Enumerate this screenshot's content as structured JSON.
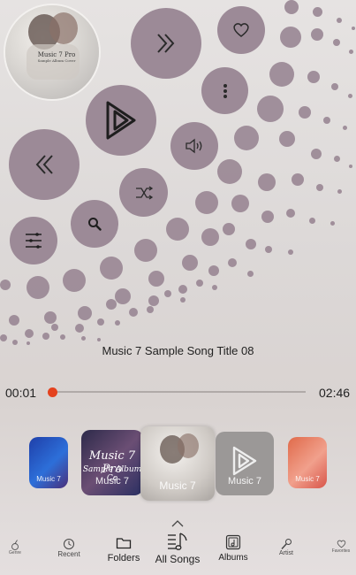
{
  "player": {
    "song_title": "Music 7 Sample Song Title 08",
    "elapsed": "00:01",
    "duration": "02:46",
    "progress": 0.006,
    "album_art_title": "Music 7 Pro",
    "album_art_subtitle": "Sample Album Cover"
  },
  "controls": {
    "icons": [
      "fast-forward-icon",
      "heart-icon",
      "more-vertical-icon",
      "play-icon",
      "volume-icon",
      "rewind-icon",
      "shuffle-icon",
      "search-icon",
      "queue-icon"
    ]
  },
  "carousel": {
    "cards": [
      {
        "label": "Music 7",
        "art_text": ""
      },
      {
        "label": "Music 7",
        "art_text": "Music 7 Pro"
      },
      {
        "label": "Music 7",
        "art_text": ""
      },
      {
        "label": "Music 7",
        "art_text": ""
      },
      {
        "label": "Music 7",
        "art_text": ""
      }
    ],
    "card_subtitle": "Sample Album Co"
  },
  "nav": {
    "items": [
      {
        "label": "Genre"
      },
      {
        "label": "Recent"
      },
      {
        "label": "Folders"
      },
      {
        "label": "All Songs"
      },
      {
        "label": "Albums"
      },
      {
        "label": "Artist"
      },
      {
        "label": "Favorites"
      }
    ]
  },
  "colors": {
    "button": "#9c8a97",
    "seek_knob": "#e4421e",
    "icon": "#2a2a2a"
  }
}
